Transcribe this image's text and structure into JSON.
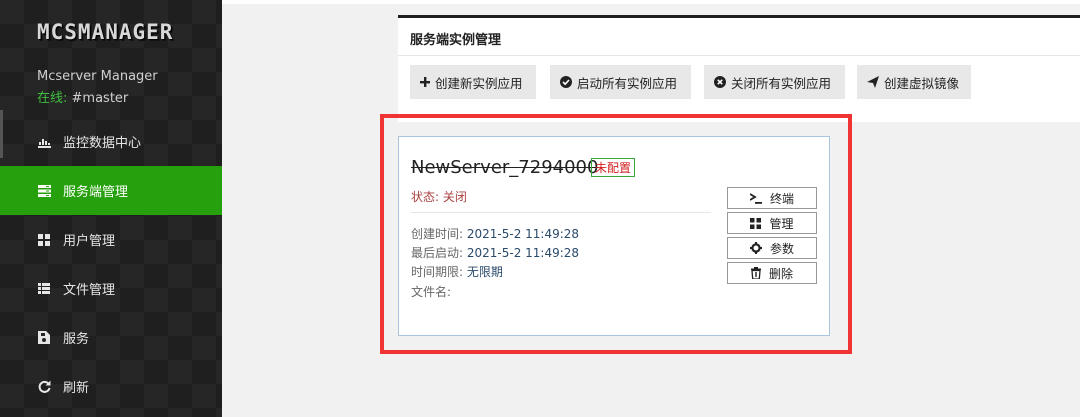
{
  "sidebar": {
    "logo": "MCSMANAGER",
    "user_name": "Mcserver Manager",
    "status_label": "在线:",
    "status_value": " #master",
    "items": [
      {
        "label": "监控数据中心",
        "icon": "bar-chart-icon"
      },
      {
        "label": "服务端管理",
        "icon": "server-icon",
        "active": true
      },
      {
        "label": "用户管理",
        "icon": "grid-icon"
      },
      {
        "label": "文件管理",
        "icon": "list-icon"
      },
      {
        "label": "服务",
        "icon": "service-icon"
      },
      {
        "label": "刷新",
        "icon": "refresh-icon"
      }
    ]
  },
  "panel": {
    "title": "服务端实例管理",
    "buttons": [
      {
        "label": "创建新实例应用",
        "icon": "plus-icon"
      },
      {
        "label": "启动所有实例应用",
        "icon": "check-circle-icon"
      },
      {
        "label": "关闭所有实例应用",
        "icon": "x-circle-icon"
      },
      {
        "label": "创建虚拟镜像",
        "icon": "send-icon"
      }
    ]
  },
  "card": {
    "name": "NewServer_7294000",
    "badge": "未配置",
    "status_label": "状态: ",
    "status_value": "关闭",
    "created_label": "创建时间: ",
    "created_value": "2021-5-2 11:49:28",
    "last_start_label": "最后启动: ",
    "last_start_value": "2021-5-2 11:49:28",
    "expiry_label": "时间期限: ",
    "expiry_value": "无限期",
    "filename_label": "文件名: ",
    "filename_value": "",
    "actions": [
      {
        "label": "终端",
        "icon": "terminal-icon"
      },
      {
        "label": "管理",
        "icon": "grid-icon"
      },
      {
        "label": "参数",
        "icon": "gear-icon"
      },
      {
        "label": "删除",
        "icon": "trash-icon"
      }
    ]
  },
  "colors": {
    "accent": "#26a00c",
    "highlight": "#f03333",
    "sidebar_bg": "#262626"
  }
}
